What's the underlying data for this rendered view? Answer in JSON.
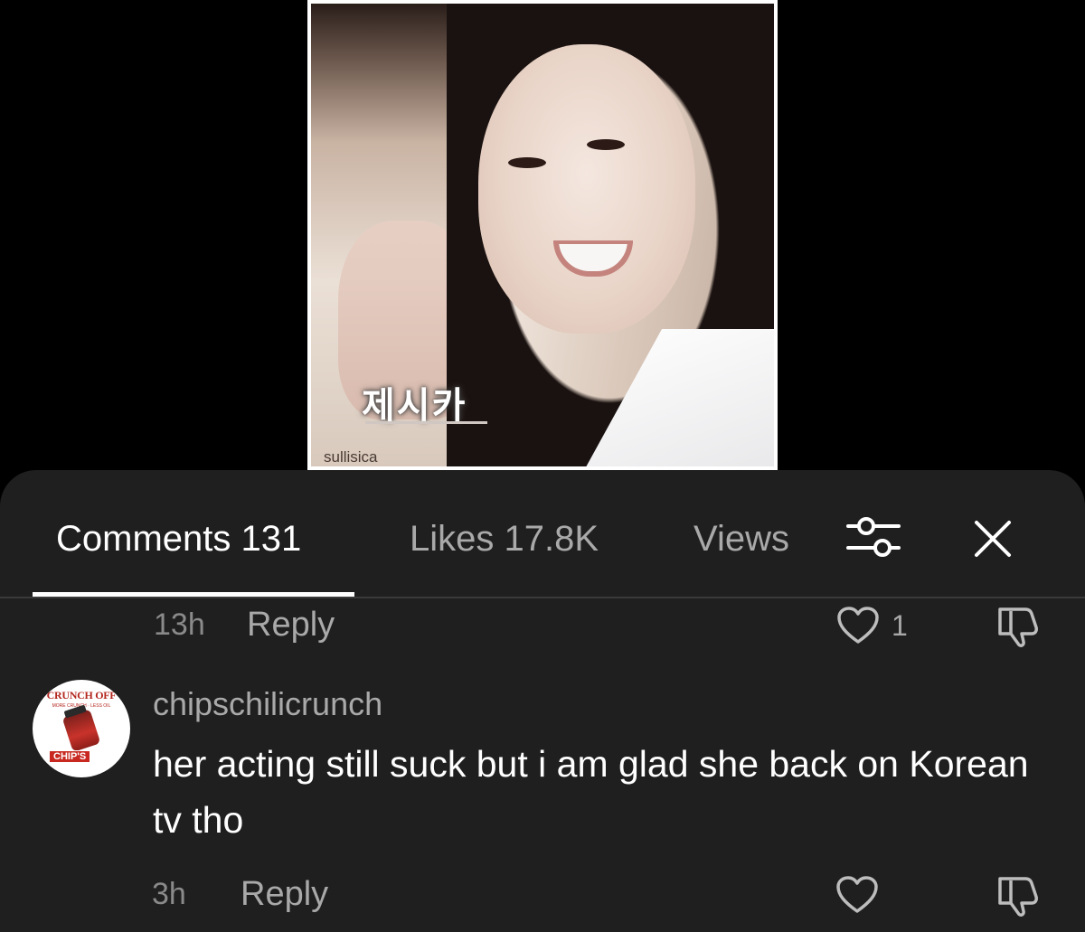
{
  "video": {
    "caption_hangul": "제시카",
    "watermark": "sullisica"
  },
  "tabs": {
    "comments_label": "Comments 131",
    "likes_label": "Likes 17.8K",
    "views_label": "Views"
  },
  "icons": {
    "filter": "sliders-filter-icon",
    "close": "close-icon",
    "like": "heart-icon",
    "dislike": "thumbs-down-icon"
  },
  "comments": [
    {
      "time": "13h",
      "reply_label": "Reply",
      "like_count": "1"
    },
    {
      "username": "chipschilicrunch",
      "avatar_text": "CRUNCH OFF",
      "avatar_badge": "CHIP'S",
      "text": "her acting still suck but i am glad she back on Korean tv tho",
      "time": "3h",
      "reply_label": "Reply",
      "like_count": ""
    }
  ],
  "colors": {
    "sheet_background": "#1f1f1f",
    "primary_text": "#ffffff",
    "secondary_text": "#a9a9a9"
  }
}
